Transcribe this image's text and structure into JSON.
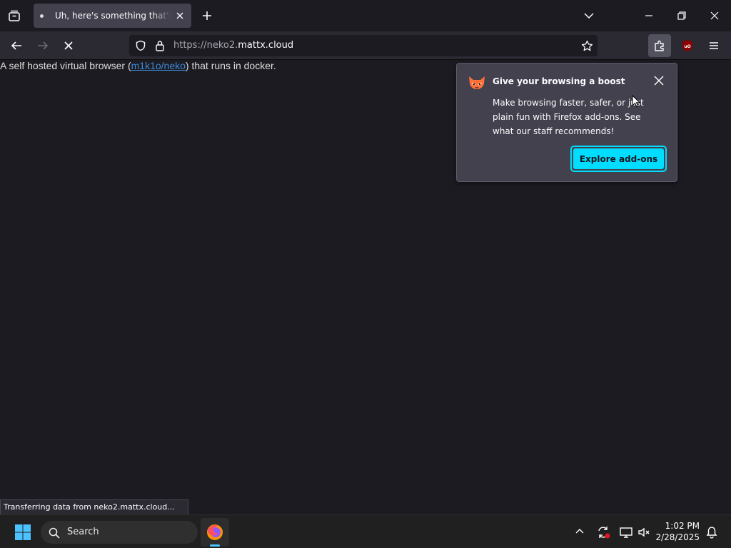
{
  "browser": {
    "tab": {
      "title": "Uh, here's something that's new"
    },
    "address": {
      "url_prefix": "https://neko2.",
      "url_domain": "mattx.cloud"
    },
    "status_text": "Transferring data from neko2.mattx.cloud..."
  },
  "page": {
    "text_before": "A self hosted virtual browser (",
    "link_text": "m1k1o/neko",
    "text_after": ") that runs in docker."
  },
  "popup": {
    "title": "Give your browsing a boost",
    "body": "Make browsing faster, safer, or just plain fun with Firefox add-ons. See what our staff recommends!",
    "button_label": "Explore add-ons",
    "accent_color": "#00ddff"
  },
  "taskbar": {
    "search_label": "Search",
    "time": "1:02 PM",
    "date": "2/28/2025"
  },
  "colors": {
    "content_bg": "#1c1b22",
    "toolbar_bg": "#2b2a33",
    "link": "#3d8ad8"
  }
}
